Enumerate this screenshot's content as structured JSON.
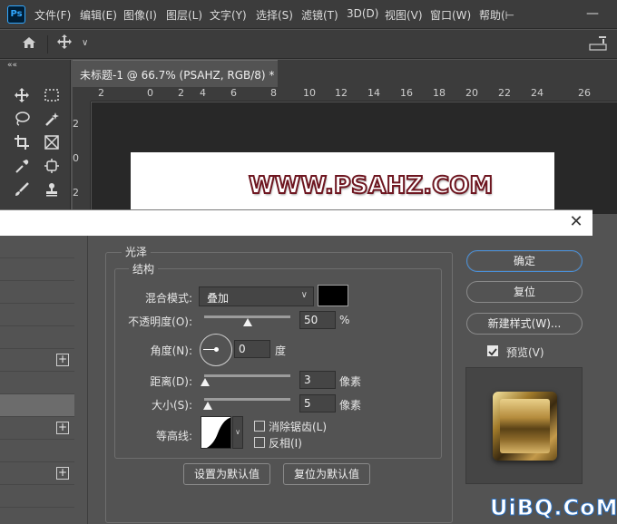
{
  "app": {
    "logo": "Ps",
    "menu": [
      "文件(F)",
      "编辑(E)",
      "图像(I)",
      "图层(L)",
      "文字(Y)",
      "选择(S)",
      "滤镜(T)",
      "3D(D)",
      "视图(V)",
      "窗口(W)",
      "帮助(⊢"
    ],
    "window_minimize": "—"
  },
  "options_bar": {
    "home_icon": "home-icon",
    "move_icon": "move-icon",
    "chevron": "∨",
    "right_glyph": "▭"
  },
  "document": {
    "tab_title": "未标题-1 @ 66.7% (PSAHZ, RGB/8) *",
    "canvas_text": "WWW.PSAHZ.COM",
    "ruler_h_labels": [
      "2",
      "0",
      "2",
      "4",
      "6",
      "8",
      "10",
      "12",
      "14",
      "16",
      "18",
      "20",
      "22",
      "24",
      "26"
    ],
    "ruler_v_labels": [
      "2",
      "0",
      "2"
    ]
  },
  "toolbox": {
    "collapse": "««",
    "tools": [
      "move-tool",
      "marquee-tool",
      "lasso-tool",
      "quick-select-tool",
      "crop-tool",
      "frame-tool",
      "eyedropper-tool",
      "spot-heal-tool",
      "brush-tool",
      "stamp-tool"
    ]
  },
  "dialog": {
    "close": "✕",
    "style_rows": [
      "",
      "",
      "",
      "",
      "",
      "",
      "",
      "",
      "",
      "",
      "",
      ""
    ],
    "group_title": "光泽",
    "structure_title": "结构",
    "blend_mode_label": "混合模式:",
    "blend_mode_value": "叠加",
    "color": "#000000",
    "opacity_label": "不透明度(O):",
    "opacity_value": "50",
    "opacity_unit": "%",
    "opacity_level": 0.5,
    "angle_label": "角度(N):",
    "angle_value": "0",
    "angle_unit": "度",
    "distance_label": "距离(D):",
    "distance_value": "3",
    "distance_unit": "像素",
    "size_label": "大小(S):",
    "size_value": "5",
    "size_unit": "像素",
    "contour_label": "等高线:",
    "antialias_label": "消除锯齿(L)",
    "invert_label": "反相(I)",
    "set_default": "设置为默认值",
    "reset_default": "复位为默认值",
    "ok": "确定",
    "reset": "复位",
    "new_style": "新建样式(W)...",
    "preview_label": "预览(V)",
    "preview_checked": true
  },
  "watermark": "UiBQ.CoM"
}
